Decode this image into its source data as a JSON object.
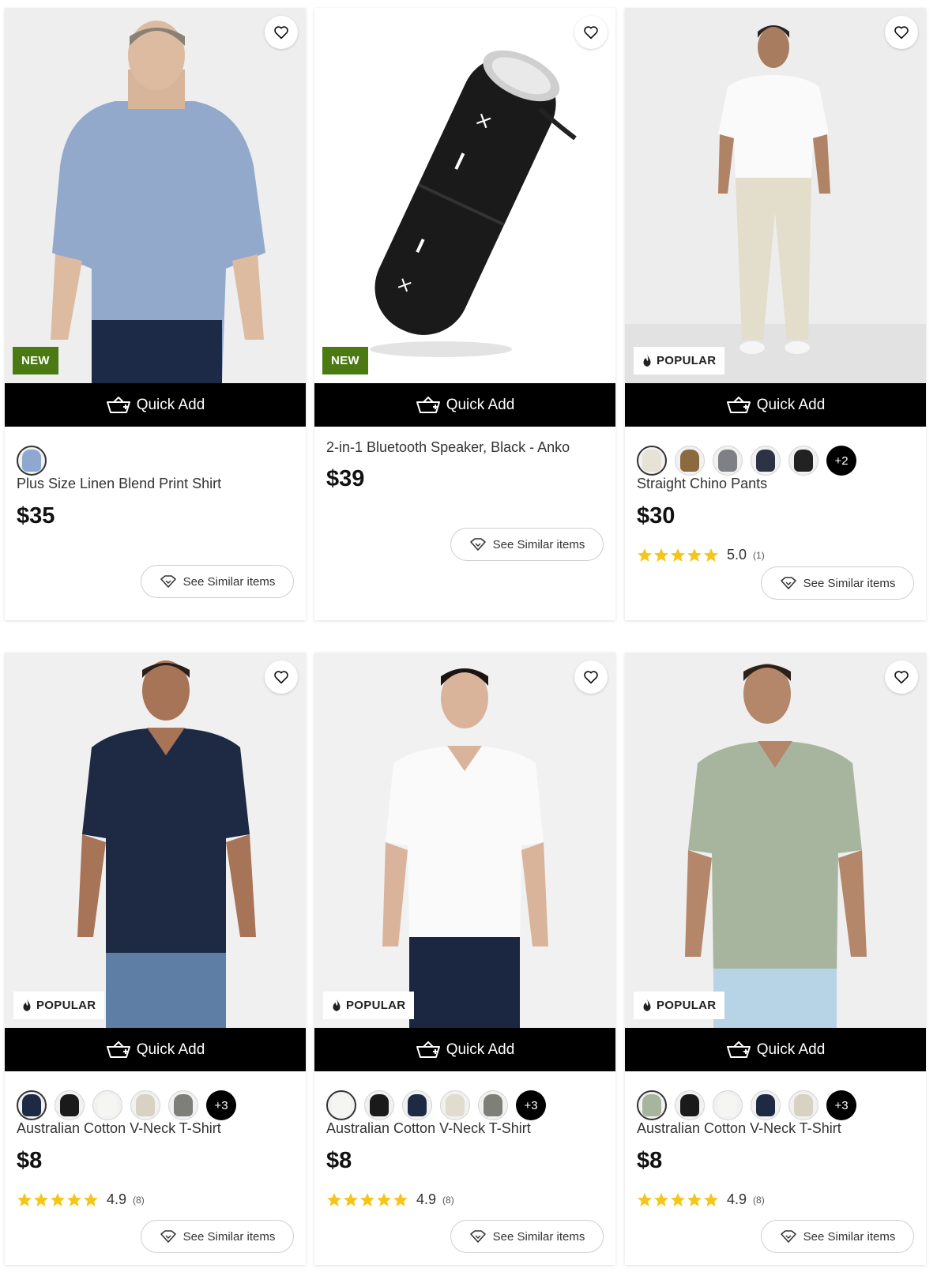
{
  "common": {
    "quick_add_label": "Quick Add",
    "similar_label": "See Similar items",
    "new_label": "NEW",
    "popular_label": "POPULAR"
  },
  "products": [
    {
      "name": "Plus Size Linen Blend Print Shirt",
      "price": "$35",
      "badge": "NEW",
      "swatches": [
        "#8fa8cf"
      ],
      "more": ""
    },
    {
      "name": "2-in-1 Bluetooth Speaker, Black - Anko",
      "price": "$39",
      "badge": "NEW"
    },
    {
      "name": "Straight Chino Pants",
      "price": "$30",
      "badge": "POPULAR",
      "swatches": [
        "#e6e2d6",
        "#8a6a3e",
        "#7e8086",
        "#2d3245",
        "#222222"
      ],
      "more": "+2",
      "rating": "5.0",
      "rating_count": "(1)"
    },
    {
      "name": "Australian Cotton V-Neck T-Shirt",
      "price": "$8",
      "badge": "POPULAR",
      "swatches": [
        "#1e2a44",
        "#1a1a1a",
        "#f5f5f2",
        "#d8d2c2",
        "#7d7f78"
      ],
      "more": "+3",
      "rating": "4.9",
      "rating_count": "(8)"
    },
    {
      "name": "Australian Cotton V-Neck T-Shirt",
      "price": "$8",
      "badge": "POPULAR",
      "swatches": [
        "#f5f5f2",
        "#1a1a1a",
        "#1e2a44",
        "#e1dccd",
        "#7d7f78"
      ],
      "more": "+3",
      "rating": "4.9",
      "rating_count": "(8)"
    },
    {
      "name": "Australian Cotton V-Neck T-Shirt",
      "price": "$8",
      "badge": "POPULAR",
      "swatches": [
        "#a8b59e",
        "#1a1a1a",
        "#f5f5f2",
        "#1e2a44",
        "#d8d2c2"
      ],
      "more": "+3",
      "rating": "4.9",
      "rating_count": "(8)"
    }
  ],
  "colors": {
    "new_badge": "#4b7a12",
    "star": "#f5c518",
    "quick_add_bg": "#000000"
  }
}
